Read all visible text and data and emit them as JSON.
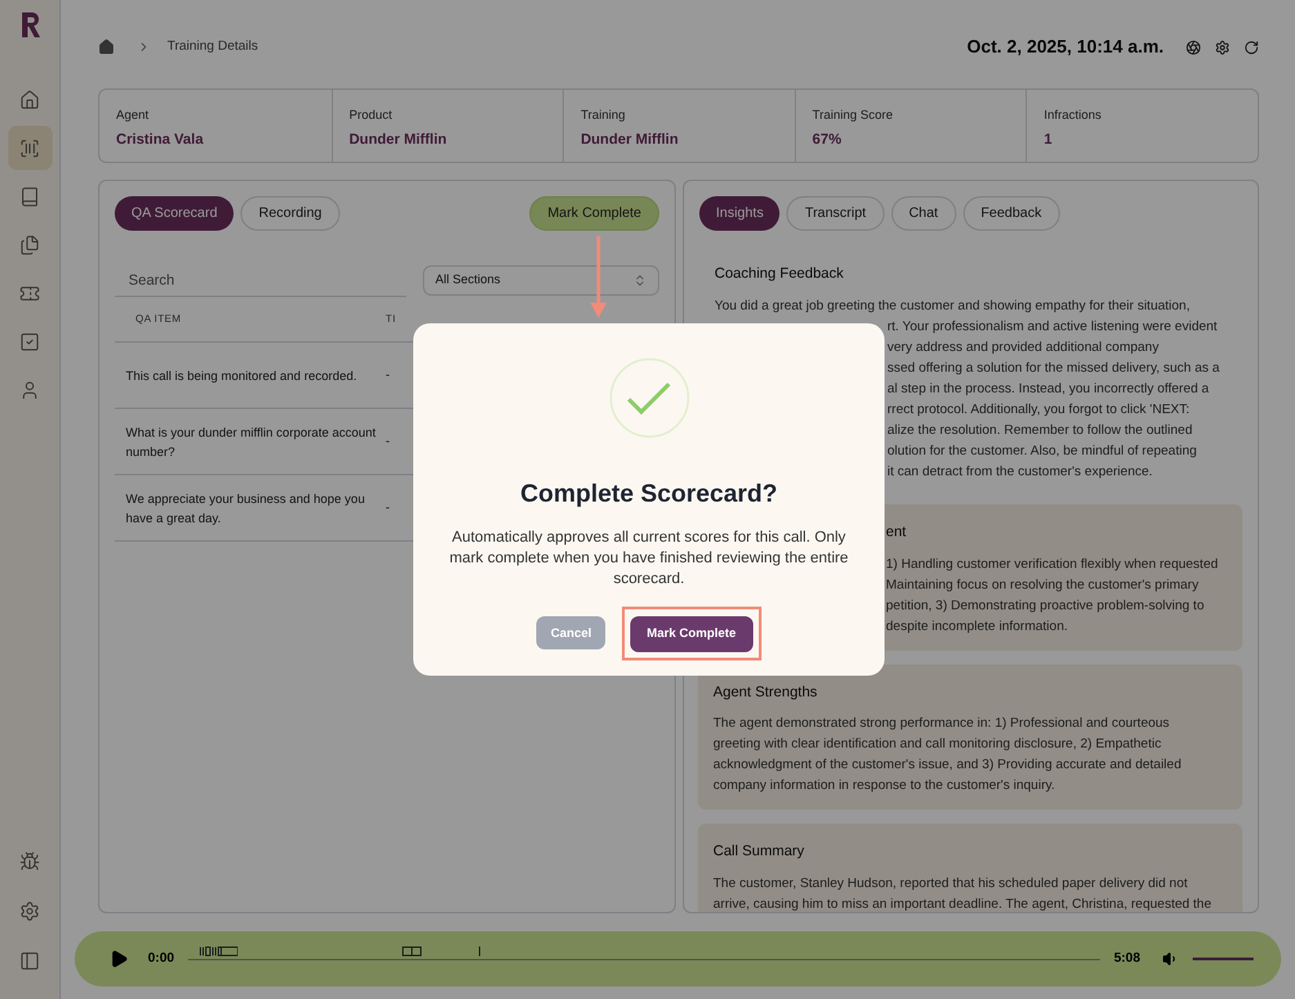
{
  "breadcrumb": {
    "current": "Training Details"
  },
  "datetime": "Oct. 2, 2025, 10:14 a.m.",
  "sidebar": {
    "items": [
      {
        "selected": false
      },
      {
        "selected": true
      },
      {
        "selected": false
      },
      {
        "selected": false
      },
      {
        "selected": false
      },
      {
        "selected": false
      },
      {
        "selected": false
      }
    ]
  },
  "stats": [
    {
      "label": "Agent",
      "value": "Cristina Vala"
    },
    {
      "label": "Product",
      "value": "Dunder Mifflin"
    },
    {
      "label": "Training",
      "value": "Dunder Mifflin"
    },
    {
      "label": "Training Score",
      "value": "67%"
    },
    {
      "label": "Infractions",
      "value": "1"
    }
  ],
  "left_panel": {
    "tabs": [
      {
        "label": "QA Scorecard",
        "selected": true
      },
      {
        "label": "Recording",
        "selected": false
      }
    ],
    "action": "Mark Complete",
    "search": {
      "placeholder": "Search"
    },
    "section_select": "All Sections",
    "table": {
      "columns": [
        "QA ITEM",
        "TI"
      ],
      "rows": [
        [
          "This call is being monitored and recorded.",
          "-"
        ],
        [
          "What is your dunder mifflin corporate account number?",
          "-"
        ],
        [
          "We appreciate your business and hope you have a great day.",
          "-"
        ]
      ]
    }
  },
  "right_panel": {
    "tabs": [
      {
        "label": "Insights",
        "selected": true
      },
      {
        "label": "Transcript",
        "selected": false
      },
      {
        "label": "Chat",
        "selected": false
      },
      {
        "label": "Feedback",
        "selected": false
      }
    ],
    "sections": [
      {
        "kind": "plain",
        "title": {
          "kind": "full",
          "text": "Coaching Feedback"
        },
        "lines": [
          {
            "kind": "full",
            "text": "You did a great job greeting the customer and showing empathy for their situation,"
          },
          {
            "kind": "tail",
            "text": "rt. Your professionalism and active listening were evident"
          },
          {
            "kind": "tail",
            "text": "very address and provided additional company"
          },
          {
            "kind": "tail",
            "text": "ssed offering a solution for the missed delivery, such as a"
          },
          {
            "kind": "tail",
            "text": "al step in the process. Instead, you incorrectly offered a"
          },
          {
            "kind": "tail",
            "text": "rrect protocol. Additionally, you forgot to click 'NEXT:"
          },
          {
            "kind": "tail",
            "text": "alize the resolution. Remember to follow the outlined"
          },
          {
            "kind": "tail",
            "text": "olution for the customer. Also, be mindful of repeating"
          },
          {
            "kind": "tail",
            "text": "it can detract from the customer's experience."
          }
        ]
      },
      {
        "kind": "card",
        "title": {
          "kind": "tail",
          "text": "ent"
        },
        "lines": [
          {
            "kind": "tail",
            "text": "1) Handling customer verification flexibly when requested"
          },
          {
            "kind": "tail",
            "text": "Maintaining focus on resolving the customer's primary"
          },
          {
            "kind": "tail",
            "text": "petition, 3) Demonstrating proactive problem-solving to"
          },
          {
            "kind": "tail",
            "text": "despite incomplete information."
          }
        ]
      },
      {
        "kind": "card",
        "title": {
          "kind": "full",
          "text": "Agent Strengths"
        },
        "lines": [
          {
            "kind": "full",
            "text": "The agent demonstrated strong performance in: 1) Professional and courteous"
          },
          {
            "kind": "full",
            "text": "greeting with clear identification and call monitoring disclosure, 2) Empathetic"
          },
          {
            "kind": "full",
            "text": "acknowledgment of the customer's issue, and 3) Providing accurate and detailed"
          },
          {
            "kind": "full",
            "text": "company information in response to the customer's inquiry."
          }
        ]
      },
      {
        "kind": "card",
        "title": {
          "kind": "full",
          "text": "Call Summary"
        },
        "lines": [
          {
            "kind": "full",
            "text": "The customer, Stanley Hudson, reported that his scheduled paper delivery did not"
          },
          {
            "kind": "full",
            "text": "arrive, causing him to miss an important deadline. The agent, Christina, requested the"
          }
        ]
      }
    ]
  },
  "player": {
    "current": "0:00",
    "duration": "5:08",
    "volume": {
      "level": 1
    }
  },
  "dialog": {
    "title": "Complete Scorecard?",
    "message": "Automatically approves all current scores for this call. Only mark complete when you have finished reviewing the entire scorecard.",
    "buttons": [
      {
        "kind": "cancel",
        "label": "Cancel"
      },
      {
        "kind": "confirm",
        "label": "Mark Complete",
        "highlighted": true
      }
    ]
  }
}
